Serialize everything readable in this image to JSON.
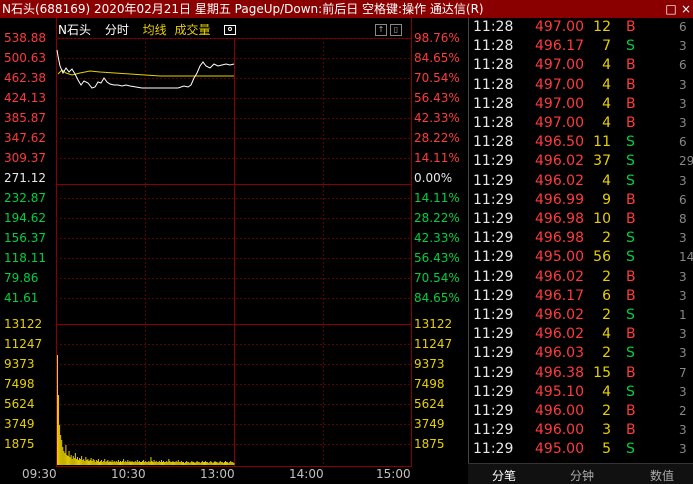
{
  "window": {
    "title": "N石头(688169) 2020年02月21日 星期五 PageUp/Down:前后日 空格键:操作 通达信(R)",
    "restore_icon": "restore-icon",
    "close_icon": "close-icon"
  },
  "chart": {
    "stock_name": "N石头",
    "tab_fenshi": "分时",
    "avg_line_label": "均线",
    "volume_label": "成交量",
    "camera_icon": "camera-icon",
    "price_labels": [
      "538.88",
      "500.63",
      "462.38",
      "424.13",
      "385.87",
      "347.62",
      "309.37",
      "271.12",
      "232.87",
      "194.62",
      "156.37",
      "118.11",
      "79.86",
      "41.61"
    ],
    "pct_labels": [
      "98.76%",
      "84.65%",
      "70.54%",
      "56.43%",
      "42.33%",
      "28.22%",
      "14.11%",
      "0.00%",
      "14.11%",
      "28.22%",
      "42.33%",
      "56.43%",
      "70.54%",
      "84.65%"
    ],
    "volume_labels": [
      "13122",
      "11247",
      "9373",
      "7498",
      "5624",
      "3749",
      "1875"
    ],
    "time_labels": [
      "09:30",
      "10:30",
      "13:00",
      "14:00",
      "15:00"
    ],
    "colors": {
      "up": "#ff3b3b",
      "down": "#00d040",
      "neutral": "#e8e8e8",
      "avg": "#e8d000",
      "grid": "#8a0000"
    }
  },
  "ticks": [
    {
      "time": "11:28",
      "price": "497.00",
      "vol": "12",
      "side": "B",
      "extra": "6"
    },
    {
      "time": "11:28",
      "price": "496.17",
      "vol": "7",
      "side": "S",
      "extra": "3"
    },
    {
      "time": "11:28",
      "price": "497.00",
      "vol": "4",
      "side": "B",
      "extra": "6"
    },
    {
      "time": "11:28",
      "price": "497.00",
      "vol": "4",
      "side": "B",
      "extra": "3"
    },
    {
      "time": "11:28",
      "price": "497.00",
      "vol": "4",
      "side": "B",
      "extra": "3"
    },
    {
      "time": "11:28",
      "price": "497.00",
      "vol": "4",
      "side": "B",
      "extra": "3"
    },
    {
      "time": "11:28",
      "price": "496.50",
      "vol": "11",
      "side": "S",
      "extra": "6"
    },
    {
      "time": "11:29",
      "price": "496.02",
      "vol": "37",
      "side": "S",
      "extra": "29"
    },
    {
      "time": "11:29",
      "price": "496.02",
      "vol": "4",
      "side": "S",
      "extra": "3"
    },
    {
      "time": "11:29",
      "price": "496.99",
      "vol": "9",
      "side": "B",
      "extra": "6"
    },
    {
      "time": "11:29",
      "price": "496.98",
      "vol": "10",
      "side": "B",
      "extra": "8"
    },
    {
      "time": "11:29",
      "price": "496.98",
      "vol": "2",
      "side": "S",
      "extra": "3"
    },
    {
      "time": "11:29",
      "price": "495.00",
      "vol": "56",
      "side": "S",
      "extra": "14"
    },
    {
      "time": "11:29",
      "price": "496.02",
      "vol": "2",
      "side": "B",
      "extra": "3"
    },
    {
      "time": "11:29",
      "price": "496.17",
      "vol": "6",
      "side": "B",
      "extra": "3"
    },
    {
      "time": "11:29",
      "price": "496.02",
      "vol": "2",
      "side": "S",
      "extra": "1"
    },
    {
      "time": "11:29",
      "price": "496.02",
      "vol": "4",
      "side": "B",
      "extra": "3"
    },
    {
      "time": "11:29",
      "price": "496.03",
      "vol": "2",
      "side": "S",
      "extra": "3"
    },
    {
      "time": "11:29",
      "price": "496.38",
      "vol": "15",
      "side": "B",
      "extra": "7"
    },
    {
      "time": "11:29",
      "price": "495.10",
      "vol": "4",
      "side": "S",
      "extra": "3"
    },
    {
      "time": "11:29",
      "price": "496.00",
      "vol": "2",
      "side": "B",
      "extra": "2"
    },
    {
      "time": "11:29",
      "price": "496.00",
      "vol": "3",
      "side": "B",
      "extra": "3"
    },
    {
      "time": "11:29",
      "price": "495.00",
      "vol": "5",
      "side": "S",
      "extra": "3"
    }
  ],
  "bottom_tabs": [
    "分笔",
    "分钟",
    "数值"
  ]
}
